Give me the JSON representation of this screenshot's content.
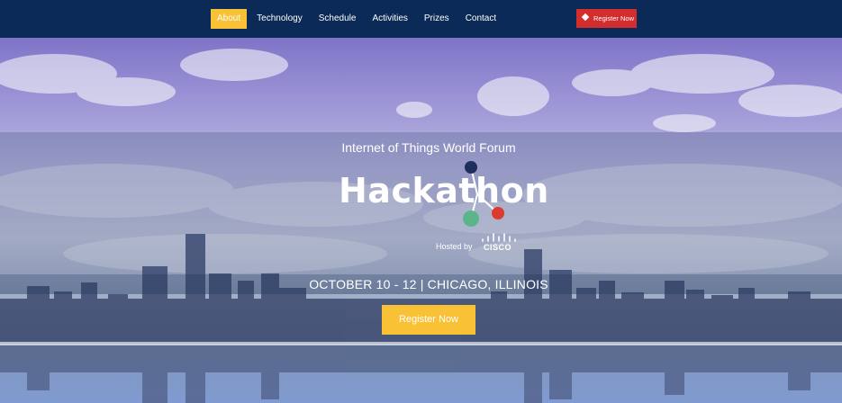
{
  "nav": {
    "items": [
      {
        "label": "About",
        "active": true
      },
      {
        "label": "Technology",
        "active": false
      },
      {
        "label": "Schedule",
        "active": false
      },
      {
        "label": "Activities",
        "active": false
      },
      {
        "label": "Prizes",
        "active": false
      },
      {
        "label": "Contact",
        "active": false
      }
    ],
    "register_label": "Register Now",
    "register_icon": "tag-icon"
  },
  "hero": {
    "event_title": "Internet of Things World Forum",
    "logo_text": "Hackathon",
    "hosted_by": "Hosted by",
    "host_logo_text": "CISCO",
    "date_location": "OCTOBER 10 - 12  |  CHICAGO, ILLINOIS",
    "cta_label": "Register Now"
  },
  "colors": {
    "nav_bg": "#0b2a57",
    "accent_yellow": "#f8c136",
    "register_red": "#d42d2d",
    "node_navy": "#1d2f5c",
    "node_green": "#5cb48b",
    "node_red": "#d93c2f"
  }
}
